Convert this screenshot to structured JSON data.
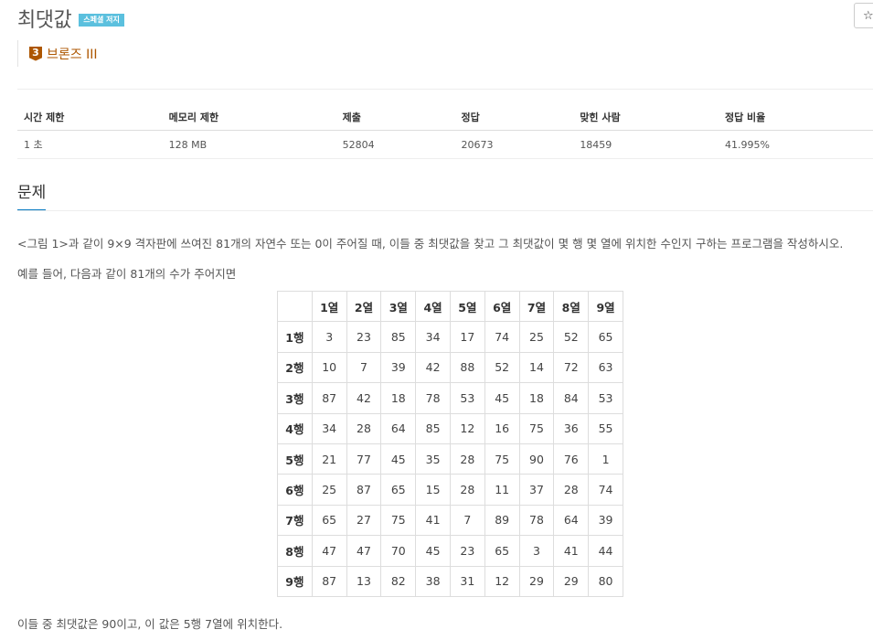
{
  "problem": {
    "title": "최댓값",
    "badge": "스페셜 저지",
    "tier_number": "3",
    "tier_label": "브론즈 III"
  },
  "info_table": {
    "headers": [
      "시간 제한",
      "메모리 제한",
      "제출",
      "정답",
      "맞힌 사람",
      "정답 비율"
    ],
    "values": [
      "1 초",
      "128 MB",
      "52804",
      "20673",
      "18459",
      "41.995%"
    ]
  },
  "section": {
    "title": "문제"
  },
  "description": {
    "line1": "<그림 1>과 같이 9×9 격자판에 쓰여진 81개의 자연수 또는 0이 주어질 때, 이들 중 최댓값을 찾고 그 최댓값이 몇 행 몇 열에 위치한 수인지 구하는 프로그램을 작성하시오.",
    "line2": "예를 들어, 다음과 같이 81개의 수가 주어지면",
    "line3": "이들 중 최댓값은 90이고, 이 값은 5행 7열에 위치한다."
  },
  "grid": {
    "corner": "",
    "col_headers": [
      "1열",
      "2열",
      "3열",
      "4열",
      "5열",
      "6열",
      "7열",
      "8열",
      "9열"
    ],
    "rows": [
      {
        "label": "1행",
        "cells": [
          "3",
          "23",
          "85",
          "34",
          "17",
          "74",
          "25",
          "52",
          "65"
        ]
      },
      {
        "label": "2행",
        "cells": [
          "10",
          "7",
          "39",
          "42",
          "88",
          "52",
          "14",
          "72",
          "63"
        ]
      },
      {
        "label": "3행",
        "cells": [
          "87",
          "42",
          "18",
          "78",
          "53",
          "45",
          "18",
          "84",
          "53"
        ]
      },
      {
        "label": "4행",
        "cells": [
          "34",
          "28",
          "64",
          "85",
          "12",
          "16",
          "75",
          "36",
          "55"
        ]
      },
      {
        "label": "5행",
        "cells": [
          "21",
          "77",
          "45",
          "35",
          "28",
          "75",
          "90",
          "76",
          "1"
        ]
      },
      {
        "label": "6행",
        "cells": [
          "25",
          "87",
          "65",
          "15",
          "28",
          "11",
          "37",
          "28",
          "74"
        ]
      },
      {
        "label": "7행",
        "cells": [
          "65",
          "27",
          "75",
          "41",
          "7",
          "89",
          "78",
          "64",
          "39"
        ]
      },
      {
        "label": "8행",
        "cells": [
          "47",
          "47",
          "70",
          "45",
          "23",
          "65",
          "3",
          "41",
          "44"
        ]
      },
      {
        "label": "9행",
        "cells": [
          "87",
          "13",
          "82",
          "38",
          "31",
          "12",
          "29",
          "29",
          "80"
        ]
      }
    ]
  },
  "toolbar": {
    "star_icon": "☆"
  },
  "colors": {
    "badge_bg": "#5bc0de",
    "bronze": "#ad5600",
    "section_underline": "#0076c0"
  }
}
